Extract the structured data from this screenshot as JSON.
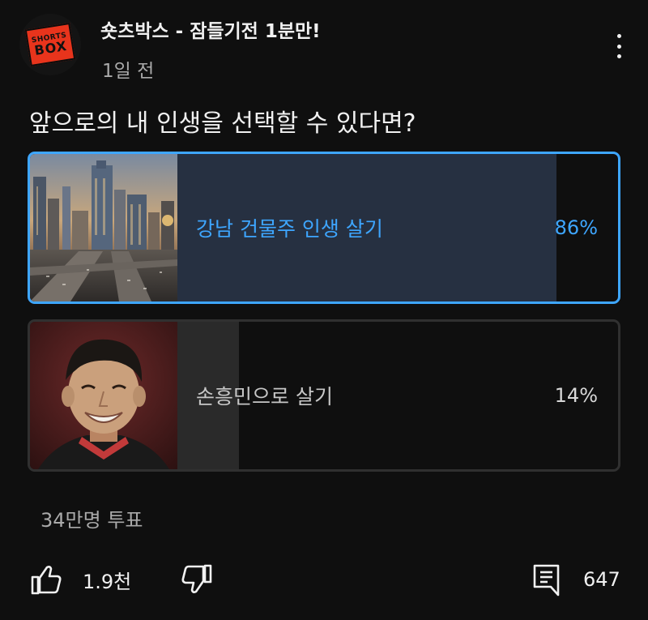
{
  "channel": {
    "name": "숏츠박스 - 잠들기전 1분만!",
    "post_time": "1일 전",
    "logo_small": "SHORTS",
    "logo_big": "BOX"
  },
  "poll": {
    "question": "앞으로의 내 인생을 선택할 수 있다면?",
    "options": [
      {
        "label": "강남 건물주 인생 살기",
        "percent": "86%",
        "fraction": 0.86,
        "selected": true,
        "image": "gangnam-city-thumbnail"
      },
      {
        "label": "손흥민으로 살기",
        "percent": "14%",
        "fraction": 0.14,
        "selected": false,
        "image": "son-heung-min-thumbnail"
      }
    ],
    "vote_count": "34만명 투표"
  },
  "actions": {
    "like_count": "1.9천",
    "comment_count": "647"
  },
  "colors": {
    "accent": "#3ea6ff",
    "background": "#0f0f0f",
    "selected_fill": "#263041",
    "unselected_fill": "#2a2a2a"
  }
}
